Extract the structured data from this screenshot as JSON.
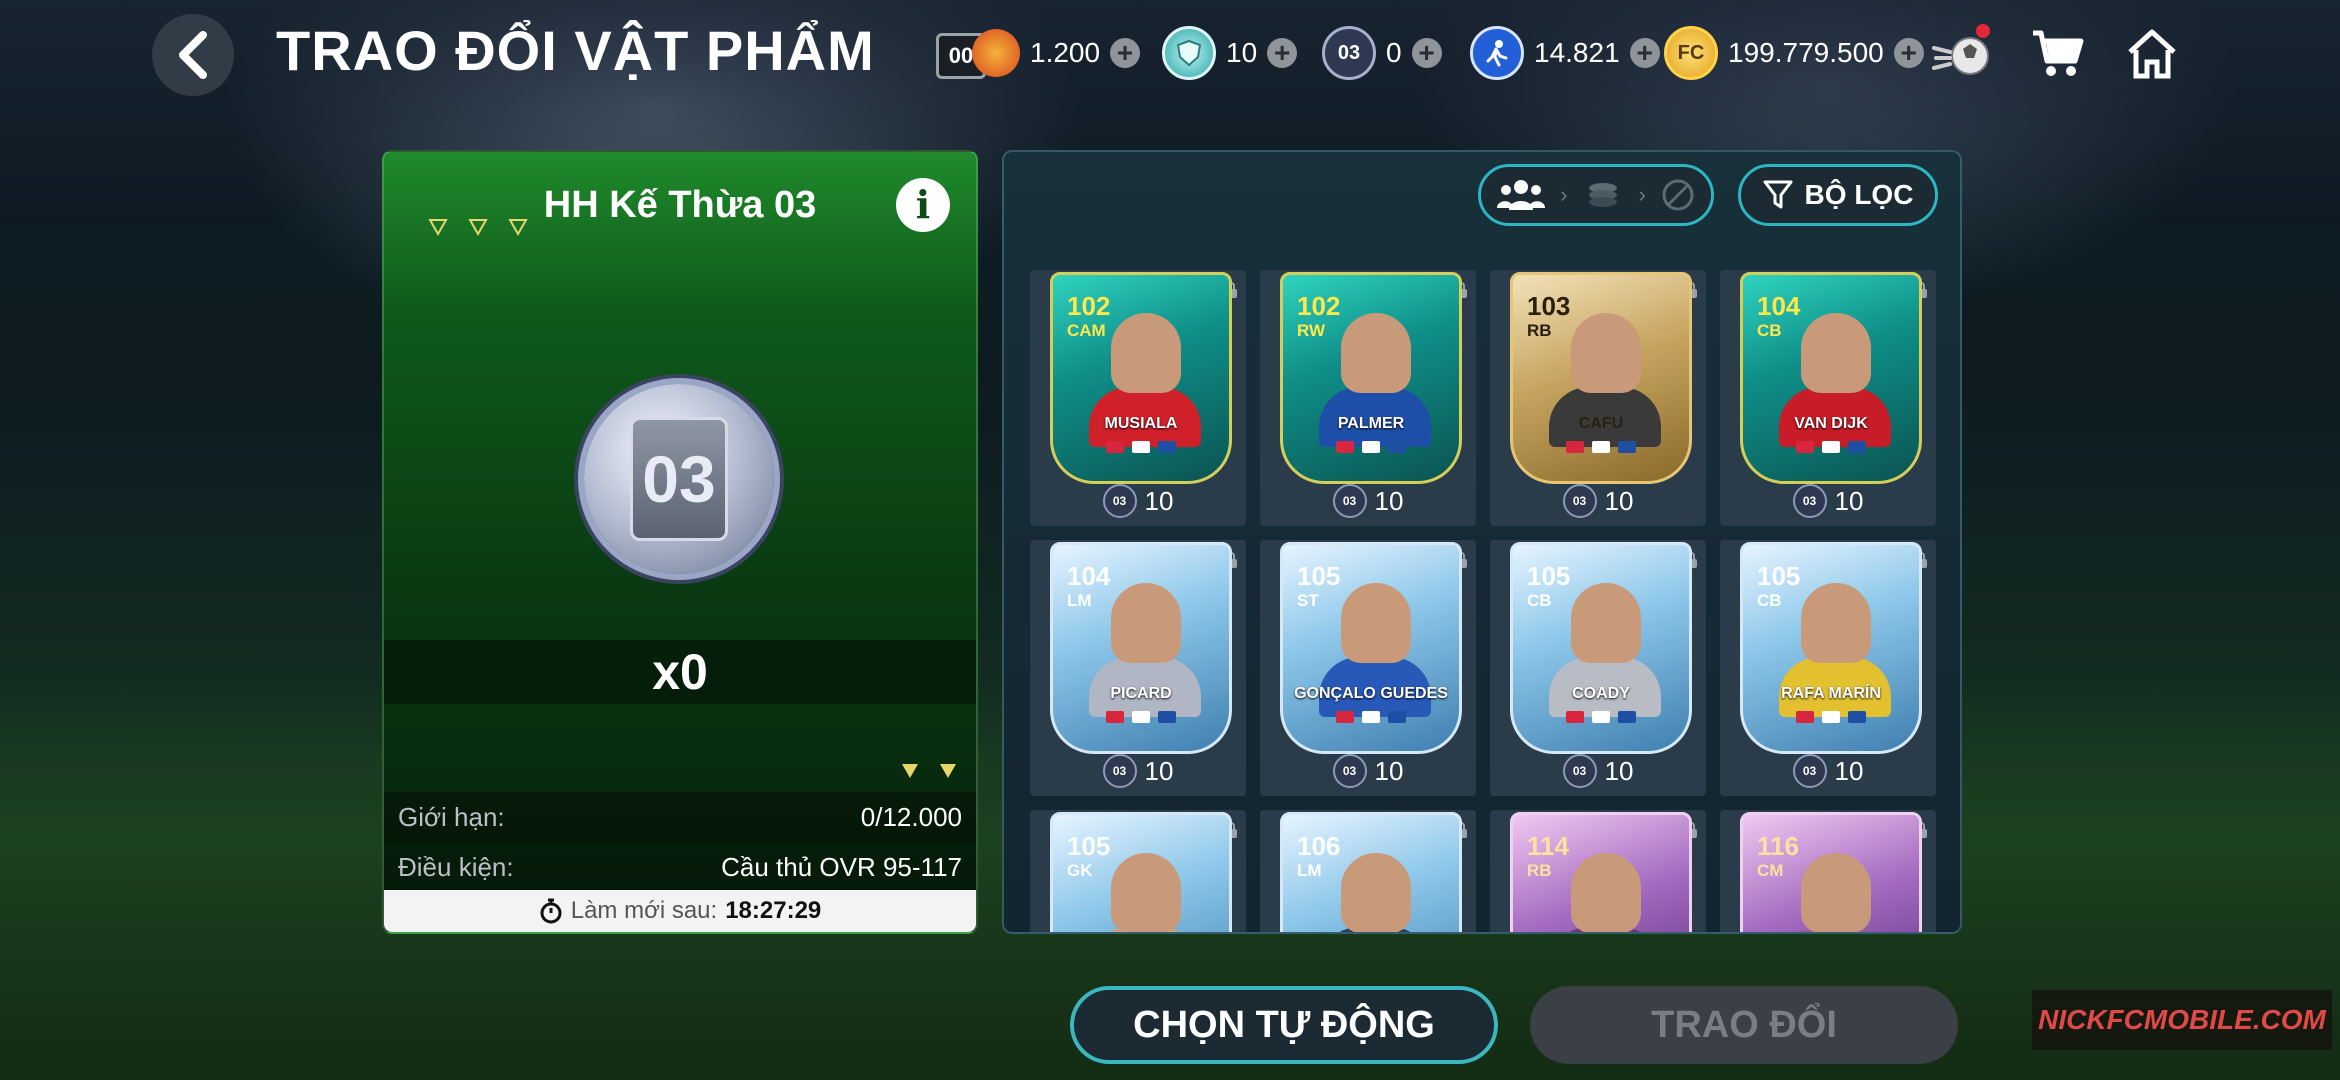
{
  "header": {
    "title": "TRAO ĐỔI VẬT PHẨM",
    "currencies": [
      {
        "name": "tokens-orange",
        "icon": "orange-token-icon",
        "value": "1.200",
        "prefix": "00"
      },
      {
        "name": "shield",
        "icon": "shield-icon",
        "value": "10"
      },
      {
        "name": "inherit-03",
        "icon": "token-03-icon",
        "value": "0",
        "label": "03"
      },
      {
        "name": "player-points",
        "icon": "runner-icon",
        "value": "14.821"
      },
      {
        "name": "fc-coins",
        "icon": "fc-coin-icon",
        "value": "199.779.500"
      }
    ],
    "icons": [
      "ball-launch-icon",
      "cart-icon",
      "home-icon"
    ]
  },
  "left_panel": {
    "title": "HH Kế Thừa 03",
    "token_label": "03",
    "count": "x0",
    "limit_label": "Giới hạn:",
    "limit_value": "0/12.000",
    "condition_label": "Điều kiện:",
    "condition_value": "Cầu thủ OVR 95-117",
    "refresh_label": "Làm mới sau:",
    "refresh_time": "18:27:29"
  },
  "right_panel": {
    "filter_label": "BỘ LỌC",
    "cards": [
      {
        "ovr": "102",
        "pos": "CAM",
        "name": "MUSIALA",
        "price": "10",
        "theme": "teal",
        "shirt": "#d0202a"
      },
      {
        "ovr": "102",
        "pos": "RW",
        "name": "PALMER",
        "price": "10",
        "theme": "teal",
        "shirt": "#1e4fa8"
      },
      {
        "ovr": "103",
        "pos": "RB",
        "name": "CAFU",
        "price": "10",
        "theme": "gold",
        "shirt": "#3a3a3a"
      },
      {
        "ovr": "104",
        "pos": "CB",
        "name": "VAN DIJK",
        "price": "10",
        "theme": "teal",
        "shirt": "#c81c28"
      },
      {
        "ovr": "104",
        "pos": "LM",
        "name": "PICARD",
        "price": "10",
        "theme": "ice",
        "shirt": "#b0b6c4"
      },
      {
        "ovr": "105",
        "pos": "ST",
        "name": "GONÇALO GUEDES",
        "price": "10",
        "theme": "ice",
        "shirt": "#2858b8"
      },
      {
        "ovr": "105",
        "pos": "CB",
        "name": "COADY",
        "price": "10",
        "theme": "ice",
        "shirt": "#b8bcc4"
      },
      {
        "ovr": "105",
        "pos": "CB",
        "name": "RAFA MARÍN",
        "price": "10",
        "theme": "ice",
        "shirt": "#e2c030"
      },
      {
        "ovr": "105",
        "pos": "GK",
        "name": "",
        "price": "",
        "theme": "ice",
        "shirt": "#c9a080"
      },
      {
        "ovr": "106",
        "pos": "LM",
        "name": "",
        "price": "",
        "theme": "ice",
        "shirt": "#2a3c60"
      },
      {
        "ovr": "114",
        "pos": "RB",
        "name": "",
        "price": "",
        "theme": "purple",
        "shirt": "#6a3a80"
      },
      {
        "ovr": "116",
        "pos": "CM",
        "name": "",
        "price": "",
        "theme": "purple",
        "shirt": "#9060a0"
      }
    ]
  },
  "footer": {
    "auto_select_label": "CHỌN TỰ ĐỘNG",
    "trade_label": "TRAO ĐỔI"
  },
  "watermark": "NICKFCMOBILE.COM",
  "colors": {
    "accent_teal": "#2cb6c2",
    "panel_green": "#0f5a1b",
    "panel_dark": "#13252f"
  }
}
